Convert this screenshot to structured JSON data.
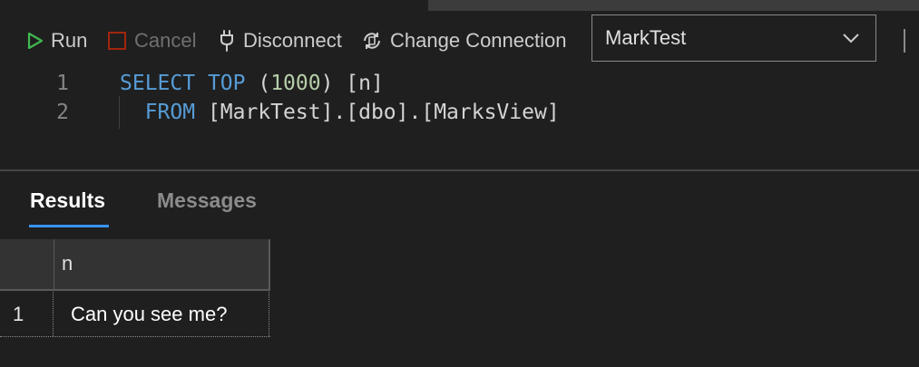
{
  "toolbar": {
    "run_label": "Run",
    "cancel_label": "Cancel",
    "disconnect_label": "Disconnect",
    "change_connection_label": "Change Connection",
    "database_selected": "MarkTest",
    "icons": {
      "run": "play-icon",
      "cancel": "stop-icon",
      "disconnect": "plug-icon",
      "change": "connection-icon",
      "dropdown": "chevron-down-icon"
    }
  },
  "editor": {
    "lines": [
      {
        "number": "1",
        "tokens": [
          "SELECT",
          " ",
          "TOP",
          " (",
          "1000",
          ") [n]"
        ]
      },
      {
        "number": "2",
        "tokens": [
          "  FROM",
          " [MarkTest].[dbo].[MarksView]"
        ]
      }
    ]
  },
  "results": {
    "tabs": [
      "Results",
      "Messages"
    ],
    "active_tab": "Results",
    "columns": [
      "n"
    ],
    "rows": [
      {
        "rownum": "1",
        "cells": [
          "Can you see me?"
        ]
      }
    ]
  },
  "colors": {
    "background": "#1f1f1f",
    "keyword": "#569cd6",
    "number": "#b5cea8",
    "accent": "#3794ff",
    "run_green": "#3fb950",
    "cancel_red": "#a1260d"
  }
}
